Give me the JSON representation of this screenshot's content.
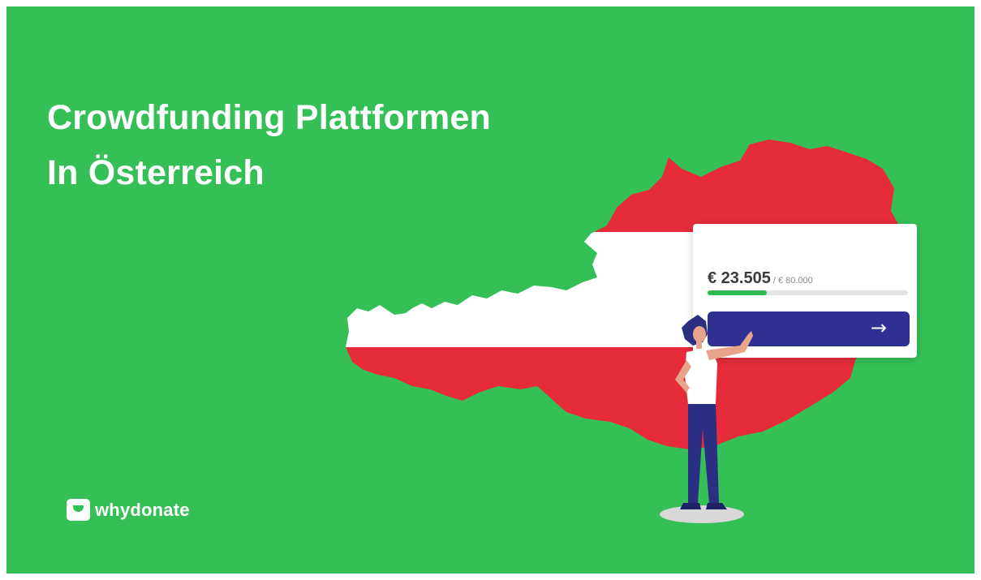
{
  "headline": {
    "line1": "Crowdfunding Plattformen",
    "line2": "In Österreich"
  },
  "donation_card": {
    "raised": "€ 23.505",
    "goal": "/ € 80.000",
    "progress_fraction": 0.294,
    "arrow_icon": "arrow-right-icon"
  },
  "brand": {
    "logo_icon": "whydonate-logo-icon",
    "name": "whydonate"
  },
  "colors": {
    "background": "#35c057",
    "flag_red": "#e62b3b",
    "flag_white": "#ffffff",
    "button": "#2e3192",
    "progress": "#2dbb4f"
  }
}
